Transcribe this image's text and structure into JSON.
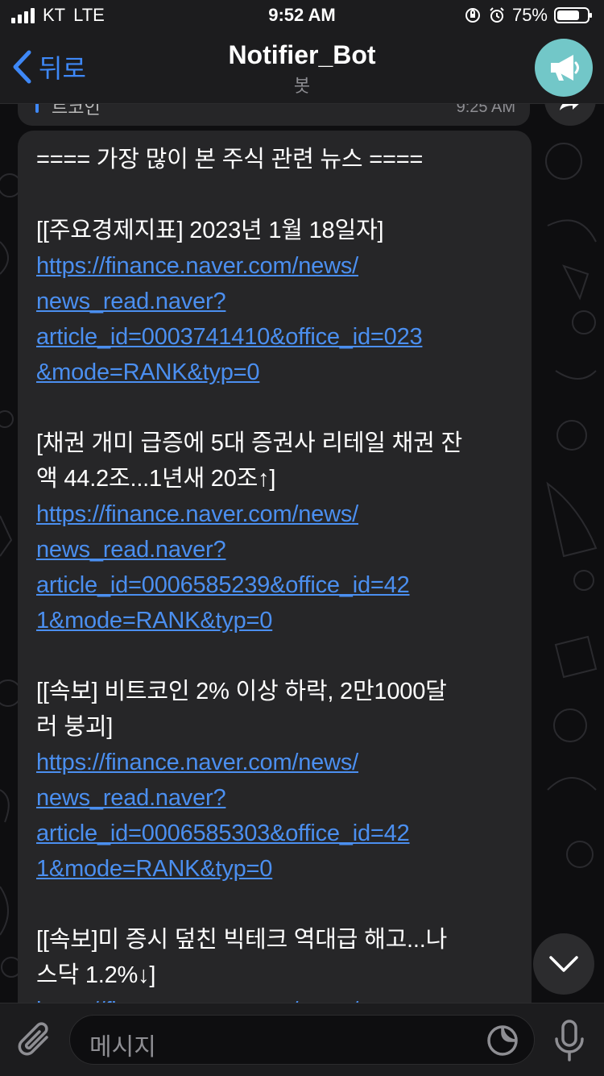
{
  "status_bar": {
    "carrier": "KT",
    "network": "LTE",
    "time": "9:52 AM",
    "battery": "75%",
    "battery_level": 0.75
  },
  "nav": {
    "back_label": "뒤로",
    "title": "Notifier_Bot",
    "subtitle": "봇",
    "avatar_icon": "megaphone-icon",
    "avatar_color": "#72c7c8"
  },
  "previous_message": {
    "text": "트코인",
    "time": "9:25 AM"
  },
  "message": {
    "lines": {
      "header": "==== 가장 많이 본 주식 관련 뉴스 ====",
      "n1_title": "[[주요경제지표] 2023년 1월 18일자]",
      "n1_url_1": "https://finance.naver.com/news/",
      "n1_url_2": "news_read.naver?",
      "n1_url_3": "article_id=0003741410&office_id=023",
      "n1_url_4": "&mode=RANK&typ=0",
      "n2_title_1": "[채권 개미 급증에 5대 증권사 리테일 채권 잔",
      "n2_title_2": "액 44.2조...1년새 20조↑]",
      "n2_url_1": "https://finance.naver.com/news/",
      "n2_url_2": "news_read.naver?",
      "n2_url_3": "article_id=0006585239&office_id=42",
      "n2_url_4": "1&mode=RANK&typ=0",
      "n3_title_1": "[[속보] 비트코인 2% 이상 하락, 2만1000달",
      "n3_title_2": "러 붕괴]",
      "n3_url_1": "https://finance.naver.com/news/",
      "n3_url_2": "news_read.naver?",
      "n3_url_3": "article_id=0006585303&office_id=42",
      "n3_url_4": "1&mode=RANK&typ=0",
      "n4_title_1": "[[속보]미 증시 덮친 빅테크 역대급 해고...나",
      "n4_title_2": "스닥 1.2%↓]",
      "n4_url_1": "https://finance.naver.com/news/"
    }
  },
  "input": {
    "placeholder": "메시지"
  },
  "colors": {
    "accent": "#3e88f7",
    "link": "#4b8ff0",
    "bubble": "#262628",
    "background": "#0e0e10"
  }
}
